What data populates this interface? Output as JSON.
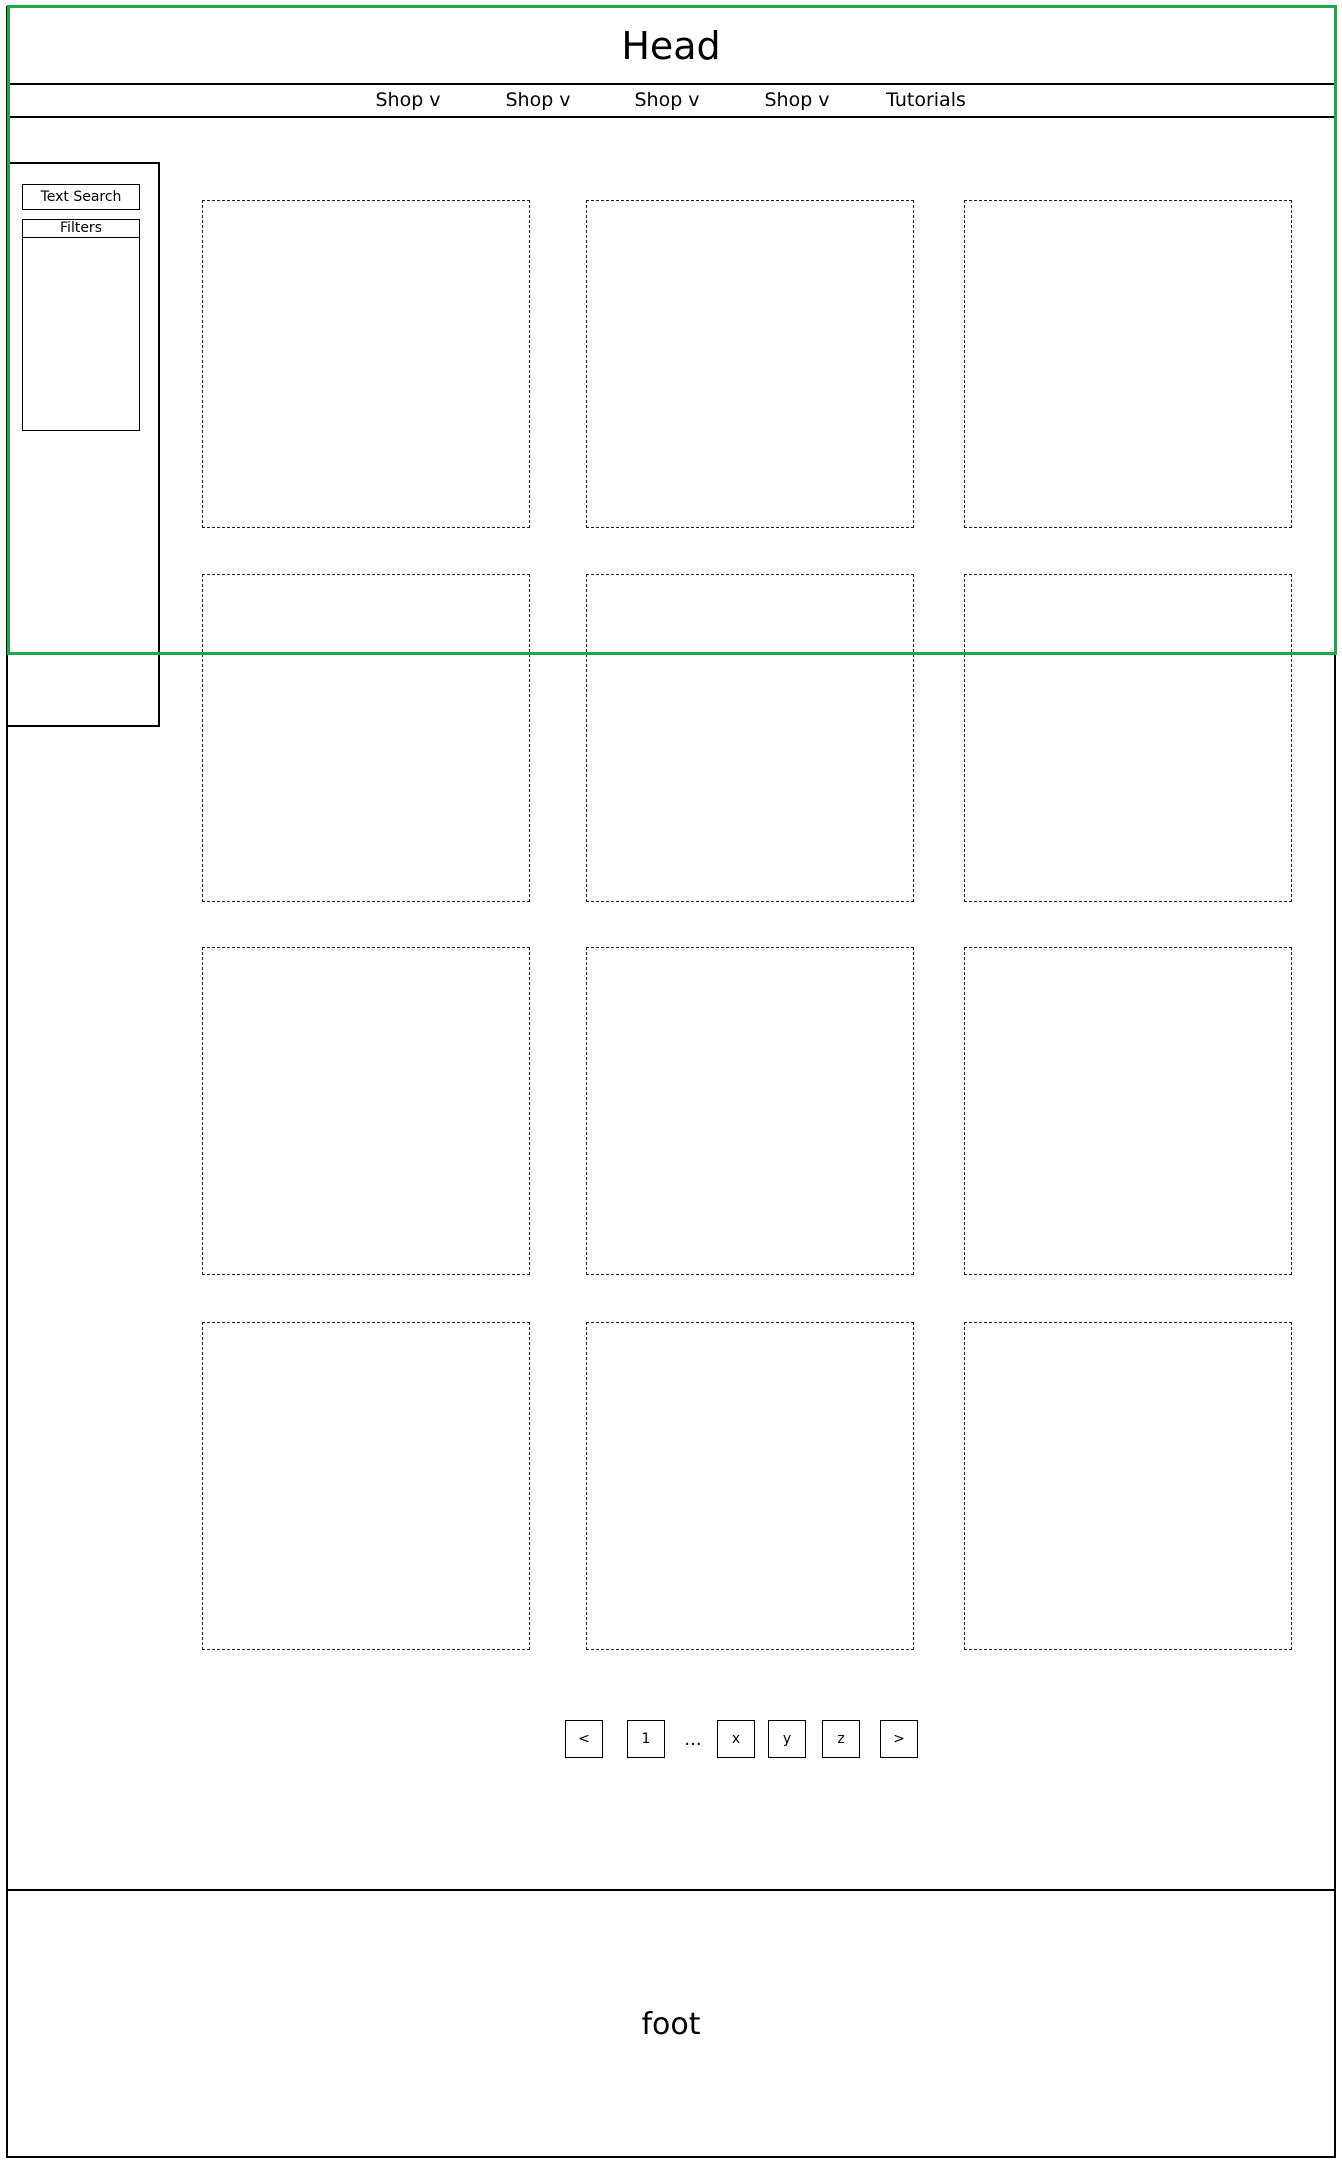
{
  "header": {
    "title": "Head"
  },
  "nav": {
    "items": [
      {
        "label": "Shop v"
      },
      {
        "label": "Shop v"
      },
      {
        "label": "Shop v"
      },
      {
        "label": "Shop v"
      },
      {
        "label": "Tutorials"
      }
    ]
  },
  "sidebar": {
    "search_label": "Text Search",
    "filters_label": "Filters"
  },
  "pagination": {
    "prev": "<",
    "first": "1",
    "ellipsis": "...",
    "pages": [
      "x",
      "y",
      "z"
    ],
    "next": ">"
  },
  "footer": {
    "label": "foot"
  },
  "colors": {
    "highlight": "#1aa84a",
    "line": "#000000"
  }
}
